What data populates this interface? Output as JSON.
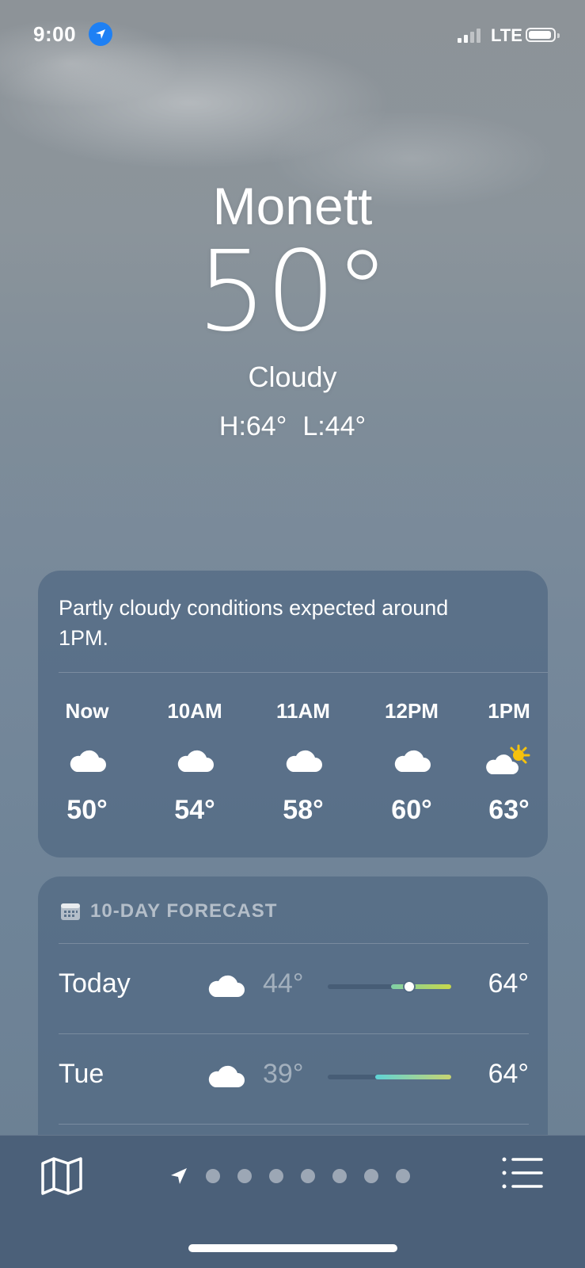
{
  "status": {
    "time": "9:00",
    "network": "LTE"
  },
  "location": {
    "city": "Monett",
    "temperature": "50°",
    "condition": "Cloudy",
    "high": "H:64°",
    "low": "L:44°"
  },
  "hourly": {
    "summary": "Partly cloudy conditions expected around 1PM.",
    "items": [
      {
        "label": "Now",
        "icon": "cloud-icon",
        "temp": "50°"
      },
      {
        "label": "10AM",
        "icon": "cloud-icon",
        "temp": "54°"
      },
      {
        "label": "11AM",
        "icon": "cloud-icon",
        "temp": "58°"
      },
      {
        "label": "12PM",
        "icon": "cloud-icon",
        "temp": "60°"
      },
      {
        "label": "1PM",
        "icon": "partly-cloudy-icon",
        "temp": "63°"
      }
    ]
  },
  "forecast": {
    "title": "10-DAY FORECAST",
    "days": [
      {
        "day": "Today",
        "icon": "cloud-icon",
        "low": "44°",
        "high": "64°",
        "range_colors": [
          "#7fd0a8",
          "#c8d84a"
        ],
        "current_marker": true
      },
      {
        "day": "Tue",
        "icon": "cloud-icon",
        "low": "39°",
        "high": "64°",
        "range_colors": [
          "#5fd3d6",
          "#c8d470"
        ],
        "current_marker": false
      }
    ]
  },
  "pager": {
    "page_count": 7
  },
  "colors": {
    "location_badge": "#1e80f4",
    "sun": "#f7c20d"
  }
}
